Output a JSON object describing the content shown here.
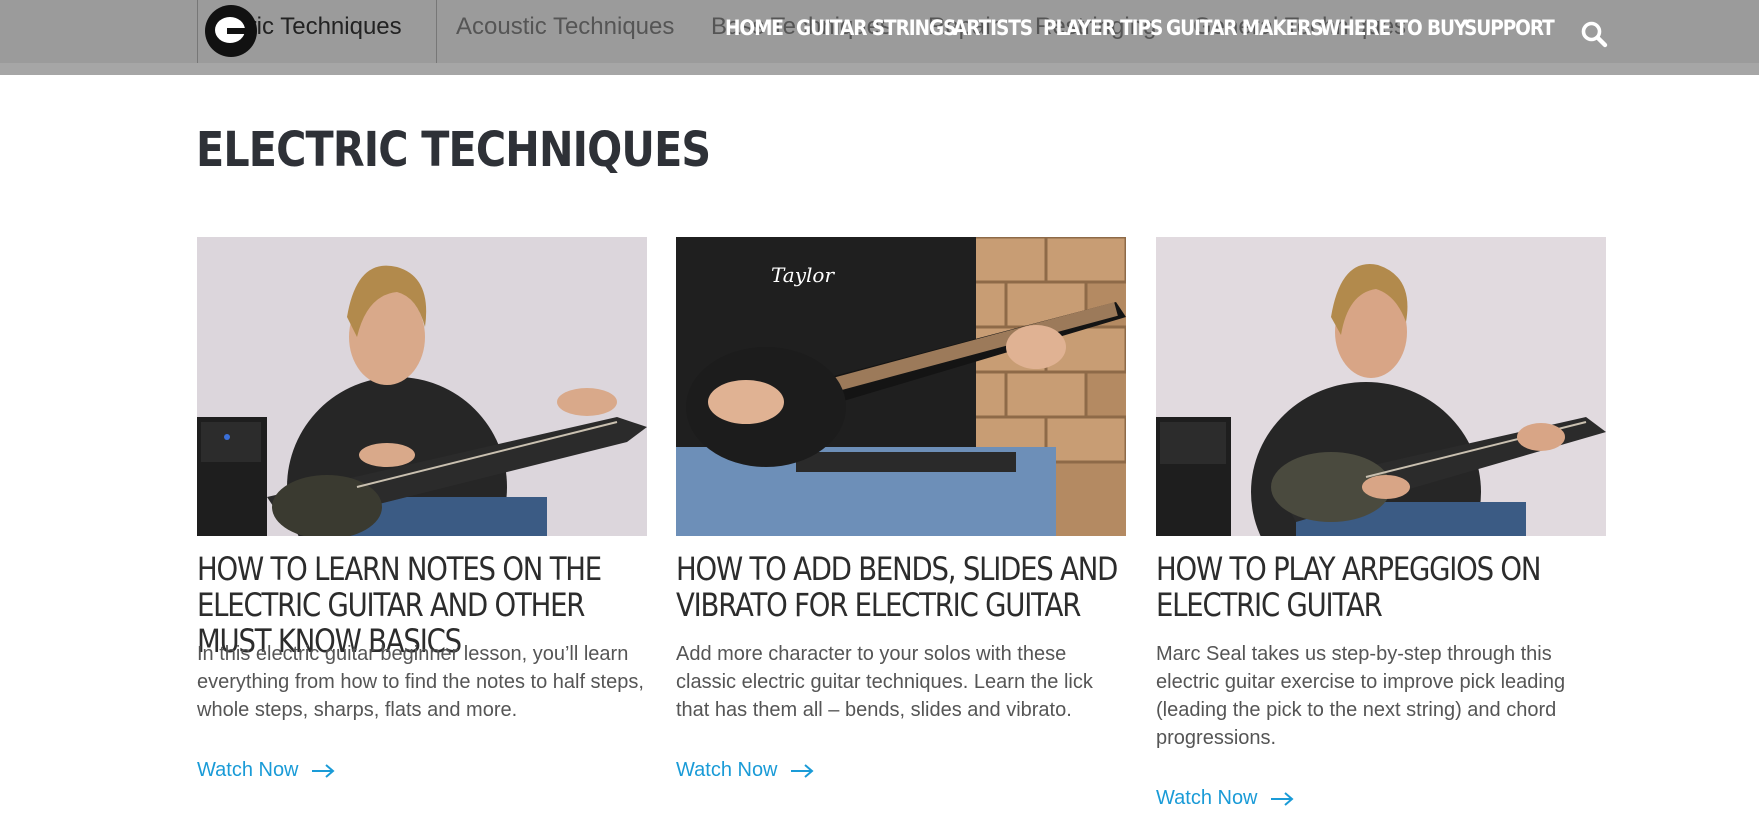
{
  "subnav": {
    "active_label": "tric Techniques",
    "tabs": [
      "Acoustic Techniques",
      "Bass Techniques",
      "Repair",
      "Restringing",
      "General Techniques"
    ]
  },
  "nav": {
    "items": [
      "HOME",
      "GUITAR STRINGS",
      "ARTISTS",
      "PLAYER TIPS",
      "GUITAR MAKERS",
      "WHERE TO BUY",
      "SUPPORT"
    ]
  },
  "page": {
    "title": "ELECTRIC TECHNIQUES"
  },
  "cards": [
    {
      "title": "HOW TO LEARN NOTES ON THE ELECTRIC GUITAR AND OTHER MUST KNOW BASICS",
      "description": "In this electric guitar beginner lesson, you’ll learn everything from how to find the notes to half steps, whole steps, sharps, flats and more.",
      "link": "Watch Now"
    },
    {
      "title": "HOW TO ADD BENDS, SLIDES AND VIBRATO FOR ELECTRIC GUITAR",
      "description": "Add more character to your solos with these classic electric guitar techniques. Learn the lick that has them all – bends, slides and vibrato.",
      "link": "Watch Now"
    },
    {
      "title": "HOW TO PLAY ARPEGGIOS ON ELECTRIC GUITAR",
      "description": "Marc Seal takes us step-by-step through this electric guitar exercise to improve pick leading (leading the pick to the next string) and chord progressions.",
      "link": "Watch Now"
    }
  ],
  "colors": {
    "header": "#9b9b9b",
    "link": "#1a9bd7",
    "title": "#2e3137"
  },
  "icons": {
    "search": "search-icon",
    "arrow": "arrow-right-icon",
    "logo": "brand-logo"
  }
}
